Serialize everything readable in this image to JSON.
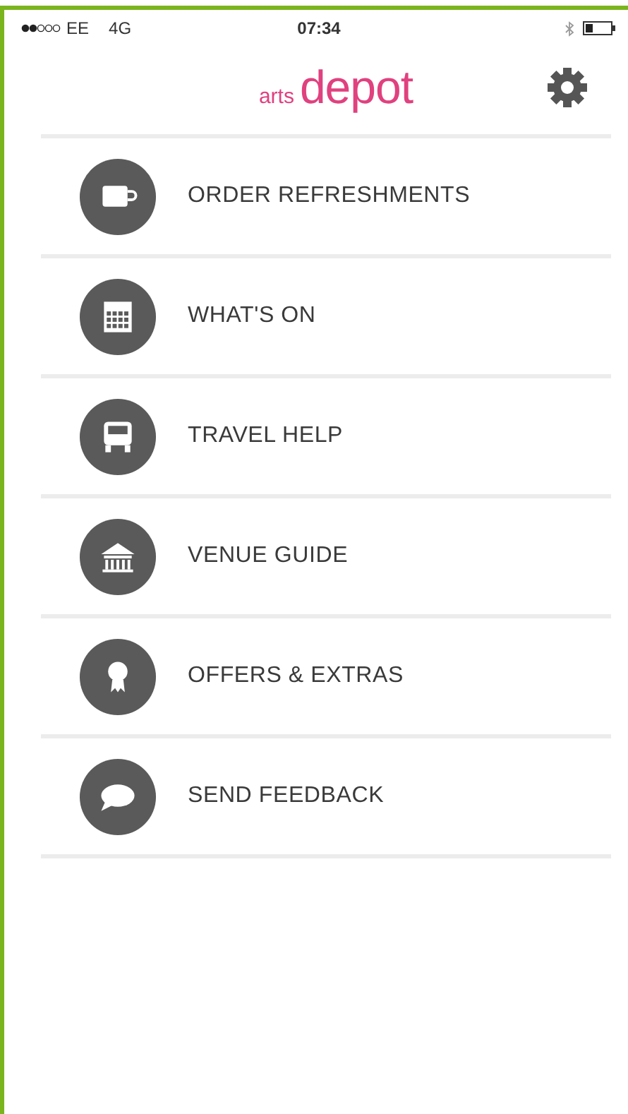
{
  "status_bar": {
    "carrier": "EE",
    "network": "4G",
    "time": "07:34"
  },
  "header": {
    "logo_small": "arts",
    "logo_large": "depot"
  },
  "menu": [
    {
      "label": "ORDER REFRESHMENTS",
      "kind": "cup"
    },
    {
      "label": "WHAT'S ON",
      "kind": "calendar"
    },
    {
      "label": "TRAVEL HELP",
      "kind": "bus"
    },
    {
      "label": "VENUE GUIDE",
      "kind": "building"
    },
    {
      "label": "OFFERS & EXTRAS",
      "kind": "award"
    },
    {
      "label": "SEND FEEDBACK",
      "kind": "speech"
    }
  ]
}
